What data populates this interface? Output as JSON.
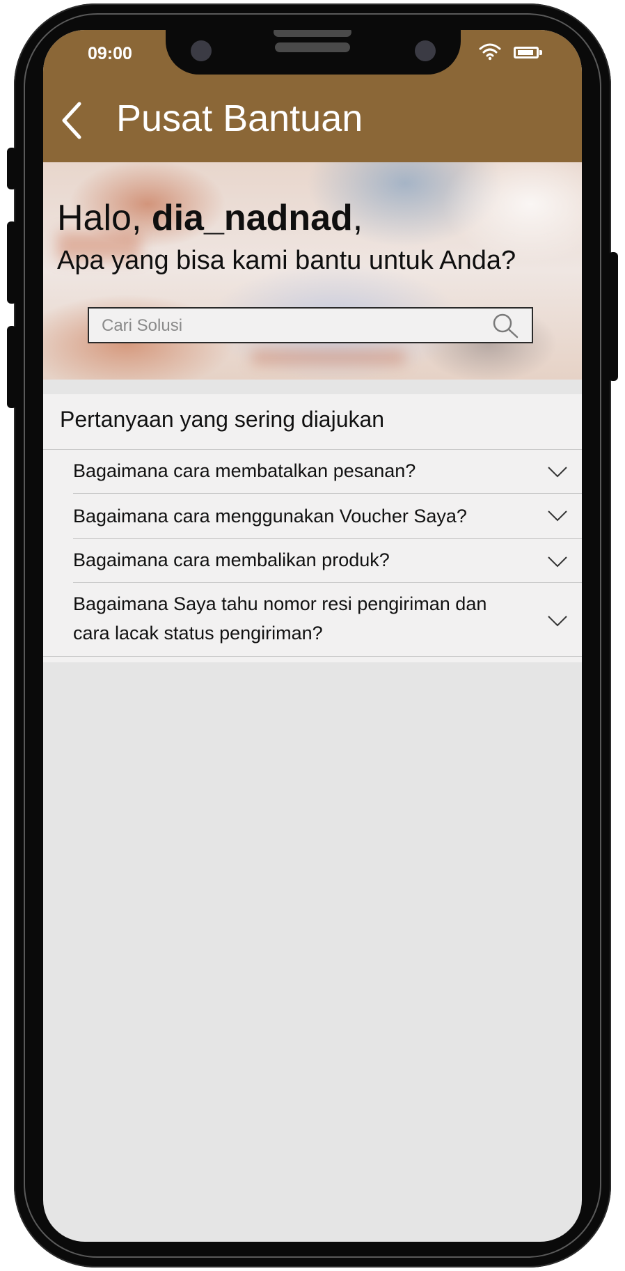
{
  "status_bar": {
    "time": "09:00"
  },
  "header": {
    "title": "Pusat Bantuan",
    "background_color": "#8b6737"
  },
  "hero": {
    "greeting_prefix": "Halo, ",
    "username": "dia_nadnad",
    "greeting_suffix": ",",
    "subtitle": "Apa yang bisa kami bantu untuk Anda?"
  },
  "search": {
    "placeholder": "Cari Solusi"
  },
  "faq": {
    "title": "Pertanyaan yang sering diajukan",
    "items": [
      {
        "question": "Bagaimana cara membatalkan pesanan?"
      },
      {
        "question": "Bagaimana cara menggunakan Voucher Saya?"
      },
      {
        "question": "Bagaimana cara membalikan produk?"
      },
      {
        "question": "Bagaimana Saya tahu nomor resi pengiriman dan cara lacak status pengiriman?"
      }
    ]
  }
}
